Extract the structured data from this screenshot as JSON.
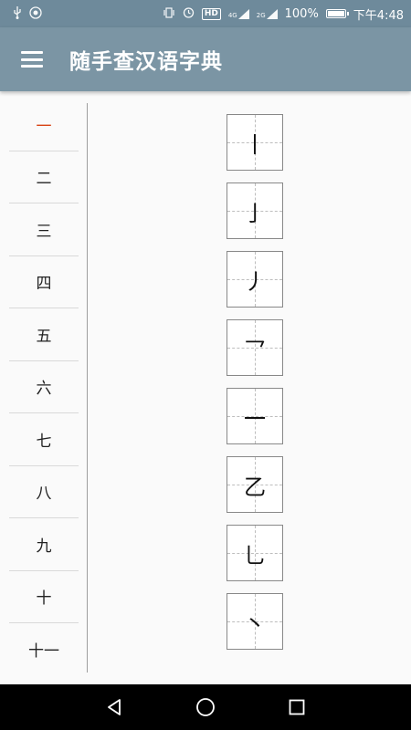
{
  "status_bar": {
    "left_icons": [
      "usb-icon",
      "android-debug-icon"
    ],
    "hd": "HD",
    "network_4g": "4G",
    "network_2g": "2G",
    "battery_percent": "100%",
    "time": "下午4:48",
    "battery_level": 1.0
  },
  "app_bar": {
    "title": "随手查汉语字典",
    "menu_icon": "hamburger-menu-icon"
  },
  "stroke_counts": [
    "一",
    "二",
    "三",
    "四",
    "五",
    "六",
    "七",
    "八",
    "九",
    "十",
    "十一"
  ],
  "selected_stroke_index": 0,
  "radicals": [
    "丨",
    "亅",
    "丿",
    "乛",
    "一",
    "乙",
    "乚",
    "丶"
  ],
  "nav_bar": [
    "back-icon",
    "home-icon",
    "recents-icon"
  ],
  "colors": {
    "status_bar": "#6e8a9b",
    "app_bar": "#7b95a4",
    "selected_text": "#d84315"
  }
}
